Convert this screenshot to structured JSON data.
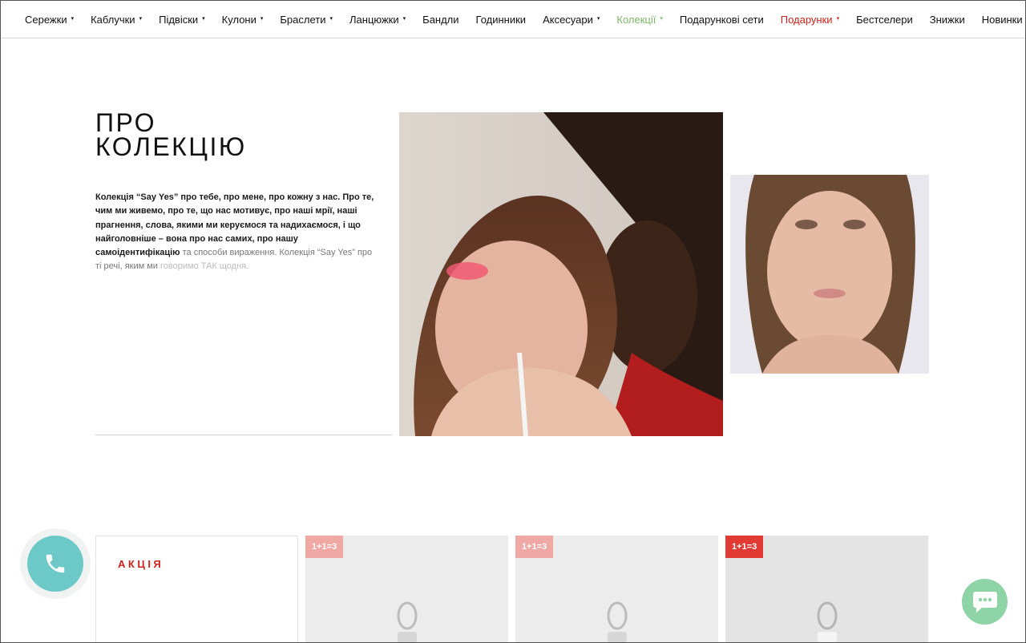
{
  "nav": {
    "items": [
      {
        "label": "Сережки",
        "caret": "▾",
        "style": "normal"
      },
      {
        "label": "Каблучки",
        "caret": "▾",
        "style": "normal"
      },
      {
        "label": "Підвіски",
        "caret": "▾",
        "style": "normal"
      },
      {
        "label": "Кулони",
        "caret": "▾",
        "style": "normal"
      },
      {
        "label": "Браслети",
        "caret": "▾",
        "style": "normal"
      },
      {
        "label": "Ланцюжки",
        "caret": "▾",
        "style": "normal"
      },
      {
        "label": "Бандли",
        "caret": "",
        "style": "normal"
      },
      {
        "label": "Годинники",
        "caret": "",
        "style": "normal"
      },
      {
        "label": "Аксесуари",
        "caret": "▾",
        "style": "normal"
      },
      {
        "label": "Колекції",
        "caret": "▾",
        "style": "green"
      },
      {
        "label": "Подарункові сети",
        "caret": "",
        "style": "normal"
      },
      {
        "label": "Подарунки",
        "caret": "▾",
        "style": "red"
      },
      {
        "label": "Бестселери",
        "caret": "",
        "style": "normal"
      },
      {
        "label": "Знижки",
        "caret": "",
        "style": "normal"
      },
      {
        "label": "Новинки",
        "caret": "",
        "style": "normal"
      }
    ],
    "colors": {
      "active_green": "#7db66b",
      "highlight_red": "#d0211b"
    }
  },
  "about": {
    "title_line1": "ПРО",
    "title_line2": "КОЛЕКЦІЮ",
    "text_main": "Колекція “Say Yes” про тебе, про мене, про кожну з нас. Про те, чим ми живемо, про те, що нас мотивує, про наші мрії, наші прагнення, слова, якими ми керуємося та надихаємося, і що найголовніше – вона про нас самих, про нашу самоідентифікацію",
    "text_fade1": " та способи вираження. Колекція “Say Yes” про ті речі, яким ми",
    "text_fade2": " говоримо ТАК щодня."
  },
  "promo": {
    "label": "АКЦІЯ",
    "badges": [
      "1+1=3",
      "1+1=3",
      "1+1=3"
    ]
  },
  "colors": {
    "teal": "#6cc9c8",
    "chat_green": "#8fd4a6",
    "badge_pink": "#f0a8a4",
    "badge_red": "#e03a32"
  },
  "icons": {
    "phone": "phone-icon",
    "chat": "chat-icon"
  }
}
